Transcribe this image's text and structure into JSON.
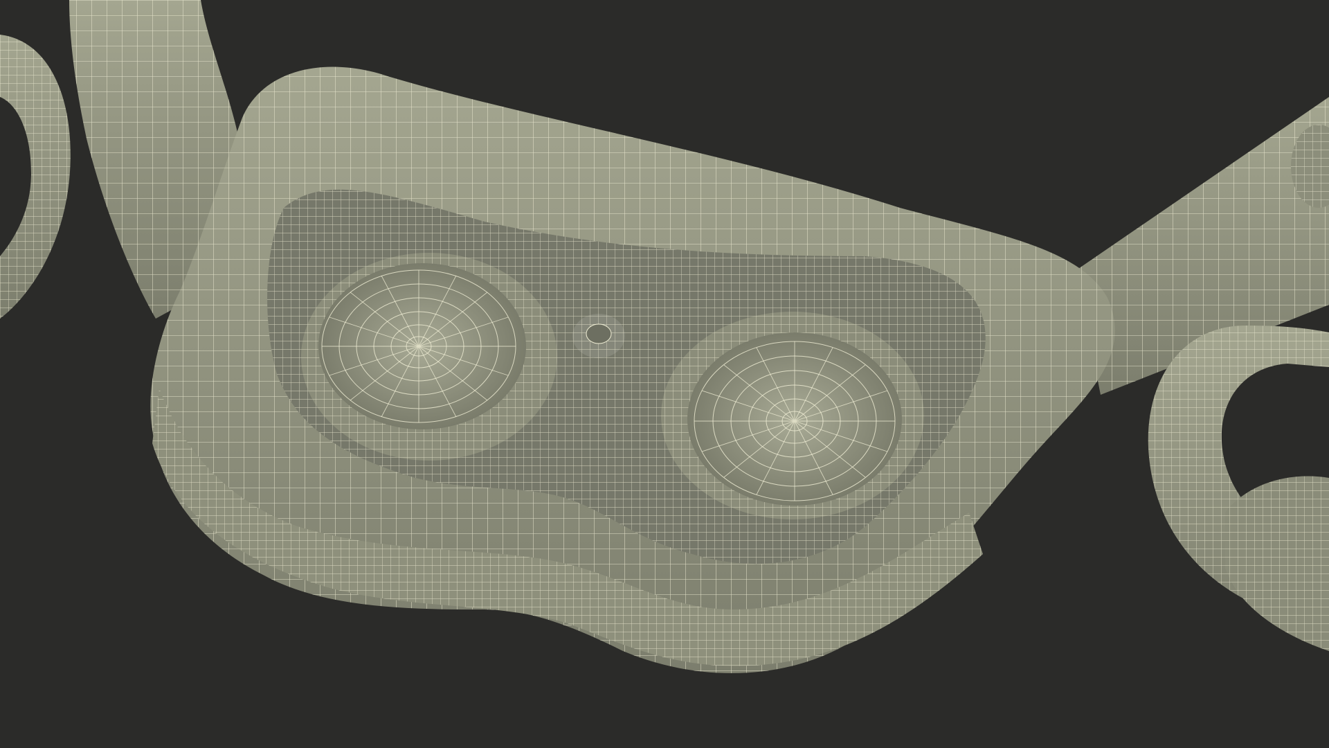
{
  "scene": {
    "description_visible_text": "",
    "background_color": "#2b2b29",
    "surface_color": "#9a9c88",
    "surface_shadow_color": "#6f7162",
    "wire_color": "#f1efd6"
  }
}
